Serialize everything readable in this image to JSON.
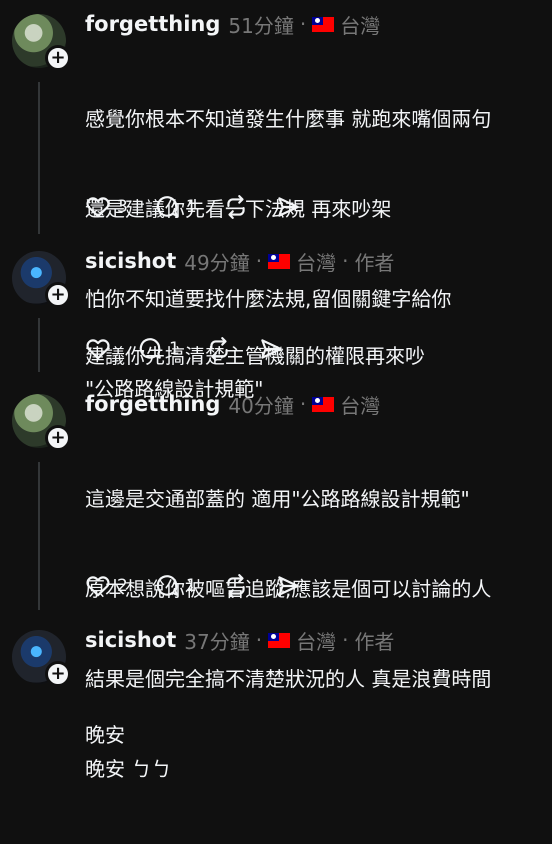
{
  "posts": [
    {
      "username": "forgetthing",
      "time": "51分鐘",
      "region": "台灣",
      "role": "",
      "lines": [
        "感覺你根本不知道發生什麼事 就跑來嘴個兩句",
        "還是建議你先看一下法規 再來吵架",
        "怕你不知道要找什麼法規,留個關鍵字給你",
        "\"公路路線設計規範\""
      ],
      "likes": "3",
      "replies": "1"
    },
    {
      "username": "sicishot",
      "time": "49分鐘",
      "region": "台灣",
      "role": "作者",
      "lines": [
        "建議你先搞清楚主管機關的權限再來吵"
      ],
      "likes": "",
      "replies": "1"
    },
    {
      "username": "forgetthing",
      "time": "40分鐘",
      "region": "台灣",
      "role": "",
      "lines": [
        "這邊是交通部蓋的 適用\"公路路線設計規範\"",
        "原本想說你被嘔吉追蹤,應該是個可以討論的人",
        "結果是個完全搞不清楚狀況的人 真是浪費時間",
        "晚安 ㄅㄅ"
      ],
      "likes": "2",
      "replies": "1"
    },
    {
      "username": "sicishot",
      "time": "37分鐘",
      "region": "台灣",
      "role": "作者",
      "lines": [
        "晚安"
      ],
      "likes": "",
      "replies": ""
    }
  ],
  "separator": "·",
  "icons": {
    "like": "heart-icon",
    "reply": "comment-icon",
    "repost": "repost-icon",
    "share": "send-icon",
    "follow": "plus-icon",
    "flag": "taiwan-flag-icon"
  }
}
